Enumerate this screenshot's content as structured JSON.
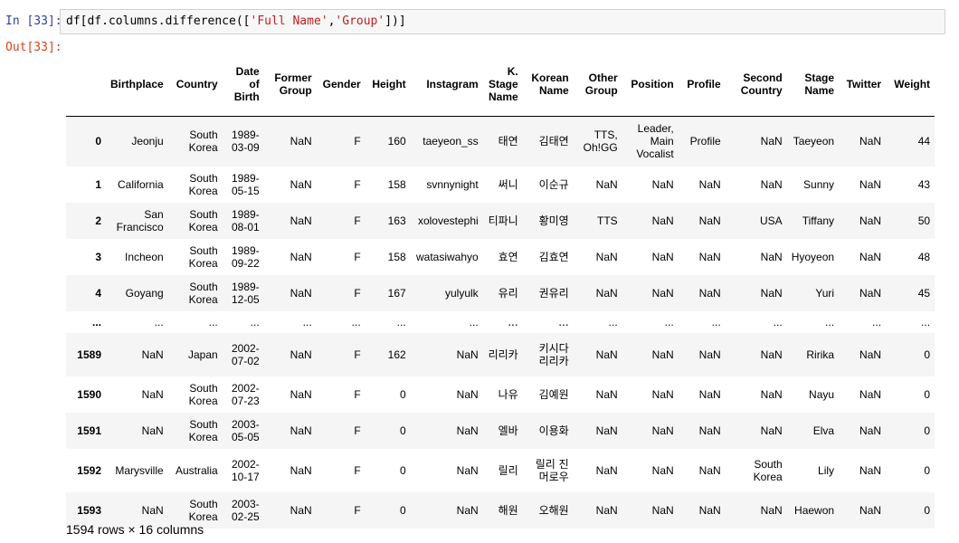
{
  "cell": {
    "in_prompt": "In [33]:",
    "out_prompt": "Out[33]:",
    "code_prefix": "df[df.columns.difference([",
    "code_str1": "'Full Name'",
    "code_comma": ",",
    "code_str2": "'Group'",
    "code_suffix": "])]"
  },
  "table": {
    "columns": [
      "Birthplace",
      "Country",
      "Date of Birth",
      "Former Group",
      "Gender",
      "Height",
      "Instagram",
      "K. Stage Name",
      "Korean Name",
      "Other Group",
      "Position",
      "Profile",
      "Second Country",
      "Stage Name",
      "Twitter",
      "Weight"
    ],
    "rows": [
      {
        "index": "0",
        "cells": [
          "Jeonju",
          "South Korea",
          "1989-03-09",
          "NaN",
          "F",
          "160",
          "taeyeon_ss",
          "태연",
          "김태연",
          "TTS, Oh!GG",
          "Leader, Main Vocalist",
          "Profile",
          "NaN",
          "Taeyeon",
          "NaN",
          "44"
        ]
      },
      {
        "index": "1",
        "cells": [
          "California",
          "South Korea",
          "1989-05-15",
          "NaN",
          "F",
          "158",
          "svnnynight",
          "써니",
          "이순규",
          "NaN",
          "NaN",
          "NaN",
          "NaN",
          "Sunny",
          "NaN",
          "43"
        ]
      },
      {
        "index": "2",
        "cells": [
          "San Francisco",
          "South Korea",
          "1989-08-01",
          "NaN",
          "F",
          "163",
          "xolovestephi",
          "티파니",
          "황미영",
          "TTS",
          "NaN",
          "NaN",
          "USA",
          "Tiffany",
          "NaN",
          "50"
        ]
      },
      {
        "index": "3",
        "cells": [
          "Incheon",
          "South Korea",
          "1989-09-22",
          "NaN",
          "F",
          "158",
          "watasiwahyo",
          "효연",
          "김효연",
          "NaN",
          "NaN",
          "NaN",
          "NaN",
          "Hyoyeon",
          "NaN",
          "48"
        ]
      },
      {
        "index": "4",
        "cells": [
          "Goyang",
          "South Korea",
          "1989-12-05",
          "NaN",
          "F",
          "167",
          "yulyulk",
          "유리",
          "권유리",
          "NaN",
          "NaN",
          "NaN",
          "NaN",
          "Yuri",
          "NaN",
          "45"
        ]
      },
      {
        "index": "...",
        "cells": [
          "...",
          "...",
          "...",
          "...",
          "...",
          "...",
          "...",
          "...",
          "...",
          "...",
          "...",
          "...",
          "...",
          "...",
          "...",
          "..."
        ]
      },
      {
        "index": "1589",
        "cells": [
          "NaN",
          "Japan",
          "2002-07-02",
          "NaN",
          "F",
          "162",
          "NaN",
          "리리카",
          "키시다 리리카",
          "NaN",
          "NaN",
          "NaN",
          "NaN",
          "Ririka",
          "NaN",
          "0"
        ]
      },
      {
        "index": "1590",
        "cells": [
          "NaN",
          "South Korea",
          "2002-07-23",
          "NaN",
          "F",
          "0",
          "NaN",
          "나유",
          "김예원",
          "NaN",
          "NaN",
          "NaN",
          "NaN",
          "Nayu",
          "NaN",
          "0"
        ]
      },
      {
        "index": "1591",
        "cells": [
          "NaN",
          "South Korea",
          "2003-05-05",
          "NaN",
          "F",
          "0",
          "NaN",
          "엘바",
          "이용화",
          "NaN",
          "NaN",
          "NaN",
          "NaN",
          "Elva",
          "NaN",
          "0"
        ]
      },
      {
        "index": "1592",
        "cells": [
          "Marysville",
          "Australia",
          "2002-10-17",
          "NaN",
          "F",
          "0",
          "NaN",
          "릴리",
          "릴리 진 머로우",
          "NaN",
          "NaN",
          "NaN",
          "South Korea",
          "Lily",
          "NaN",
          "0"
        ]
      },
      {
        "index": "1593",
        "cells": [
          "NaN",
          "South Korea",
          "2003-02-25",
          "NaN",
          "F",
          "0",
          "NaN",
          "해원",
          "오해원",
          "NaN",
          "NaN",
          "NaN",
          "NaN",
          "Haewon",
          "NaN",
          "0"
        ]
      }
    ],
    "shape": "1594 rows × 16 columns"
  }
}
